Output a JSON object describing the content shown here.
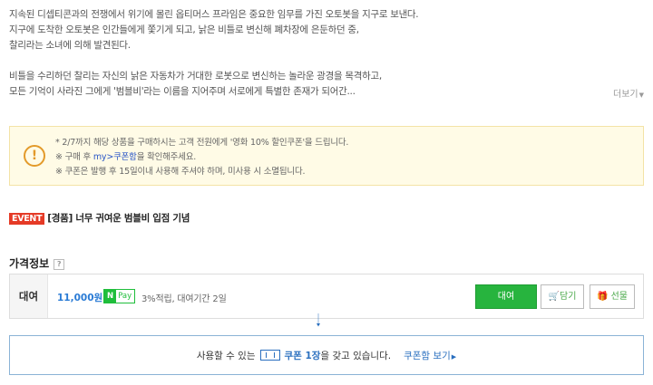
{
  "synopsis": {
    "lines": [
      "지속된 디셉티콘과의 전쟁에서 위기에 몰린 옵티머스 프라임은 중요한 임무를 가진 오토봇을 지구로 보낸다.",
      "지구에 도착한 오토봇은 인간들에게 쫓기게 되고, 낡은 비틀로 변신해 폐차장에 은둔하던 중,",
      "찰리라는 소녀에 의해 발견된다.",
      "비틀을 수리하던 찰리는 자신의 낡은 자동차가 거대한 로봇으로 변신하는 놀라운 광경을 목격하고,",
      "모든 기억이 사라진 그에게 '범블비'라는 이름을 지어주며 서로에게 특별한 존재가 되어간..."
    ],
    "more_label": "더보기"
  },
  "notice": {
    "line1": "* 2/7까지 해당 상품을 구매하시는 고객 전원에게 '영화 10% 할인쿠폰'을 드립니다.",
    "line2_prefix": "※ 구매 후 ",
    "line2_link": "my>쿠폰함",
    "line2_suffix": "을 확인해주세요.",
    "line3": "※ 쿠폰은 발행 후 15일이내 사용해 주셔야 하며, 미사용 시 소멸됩니다."
  },
  "event": {
    "badge": "EVENT",
    "text": "[경품] 너무 귀여운 범블비 입점 기념"
  },
  "price": {
    "title": "가격정보",
    "help": "?",
    "label": "대여",
    "value": "11,000원",
    "npay_n": "N",
    "npay_text": "Pay",
    "note": "3%적립, 대여기간 2일",
    "btn_rent": "대여",
    "btn_cart": "담기",
    "btn_gift": "선물"
  },
  "coupon": {
    "prefix": "사용할 수 있는",
    "strong": "쿠폰 1장",
    "suffix": "을 갖고 있습니다.",
    "link": "쿠폰함 보기"
  },
  "colors": {
    "rent_green": "#27b43e",
    "event_red": "#e53a26",
    "link_blue": "#2a6fbf"
  }
}
